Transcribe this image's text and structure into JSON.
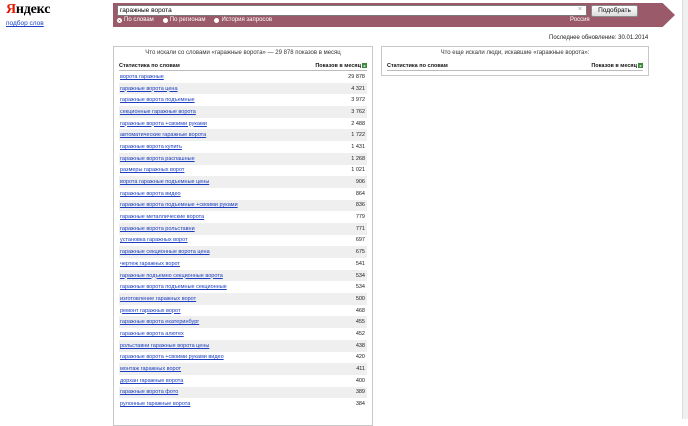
{
  "brand": {
    "logo_first": "Я",
    "logo_rest": "ндекс",
    "service_link": "подбор слов"
  },
  "search": {
    "query": "гаражные ворота",
    "button_label": "Подобрать",
    "clear_glyph": "×",
    "modes": [
      {
        "label": "По словам",
        "checked": true
      },
      {
        "label": "По регионам",
        "checked": false
      },
      {
        "label": "История запросов",
        "checked": false
      }
    ],
    "region": "Россия"
  },
  "updated": "Последнее обновление: 30.01.2014",
  "left_panel": {
    "title": "Что искали со словами «гаражные ворота» — 29 878 показов в месяц",
    "col_phrase": "Статистика по словам",
    "col_count": "Показов в месяц",
    "rows": [
      {
        "phrase": "ворота гаражные",
        "count": "29 878"
      },
      {
        "phrase": "гаражные ворота цена",
        "count": "4 321"
      },
      {
        "phrase": "гаражные ворота подъемные",
        "count": "3 972"
      },
      {
        "phrase": "секционные гаражные ворота",
        "count": "3 762"
      },
      {
        "phrase": "гаражные ворота +своими руками",
        "count": "2 488"
      },
      {
        "phrase": "автоматические гаражные ворота",
        "count": "1 722"
      },
      {
        "phrase": "гаражные ворота купить",
        "count": "1 431"
      },
      {
        "phrase": "гаражные ворота распашные",
        "count": "1 268"
      },
      {
        "phrase": "размеры гаражных ворот",
        "count": "1 021"
      },
      {
        "phrase": "ворота гаражные подъемные цены",
        "count": "906"
      },
      {
        "phrase": "гаражные ворота видео",
        "count": "864"
      },
      {
        "phrase": "гаражные ворота подъемные +своими руками",
        "count": "836"
      },
      {
        "phrase": "гаражные металлические ворота",
        "count": "779"
      },
      {
        "phrase": "гаражные ворота рольставни",
        "count": "771"
      },
      {
        "phrase": "установка гаражных ворот",
        "count": "697"
      },
      {
        "phrase": "гаражные секционные ворота цена",
        "count": "675"
      },
      {
        "phrase": "чертеж гаражных ворот",
        "count": "541"
      },
      {
        "phrase": "гаражные подъемно секционные ворота",
        "count": "534"
      },
      {
        "phrase": "гаражные ворота подъемные секционные",
        "count": "534"
      },
      {
        "phrase": "изготовление гаражных ворот",
        "count": "500"
      },
      {
        "phrase": "ремонт гаражных ворот",
        "count": "468"
      },
      {
        "phrase": "гаражные ворота екатеринбург",
        "count": "455"
      },
      {
        "phrase": "гаражные ворота алютех",
        "count": "452"
      },
      {
        "phrase": "рольставни гаражные ворота цены",
        "count": "438"
      },
      {
        "phrase": "гаражные ворота +своими руками видео",
        "count": "420"
      },
      {
        "phrase": "монтаж гаражных ворот",
        "count": "411"
      },
      {
        "phrase": "дорхан гаражные ворота",
        "count": "400"
      },
      {
        "phrase": "гаражные ворота фото",
        "count": "389"
      },
      {
        "phrase": "рулонные гаражные ворота",
        "count": "384"
      }
    ]
  },
  "right_panel": {
    "title": "Что еще искали люди, искавшие «гаражные ворота»:",
    "col_phrase": "Статистика по словам",
    "col_count": "Показов в месяц"
  },
  "icons": {
    "excel": "excel-icon",
    "clear": "close-icon"
  },
  "colors": {
    "header_bar": "#9a5a6a",
    "link": "#1a3dc1",
    "logo_accent": "#e61400"
  }
}
